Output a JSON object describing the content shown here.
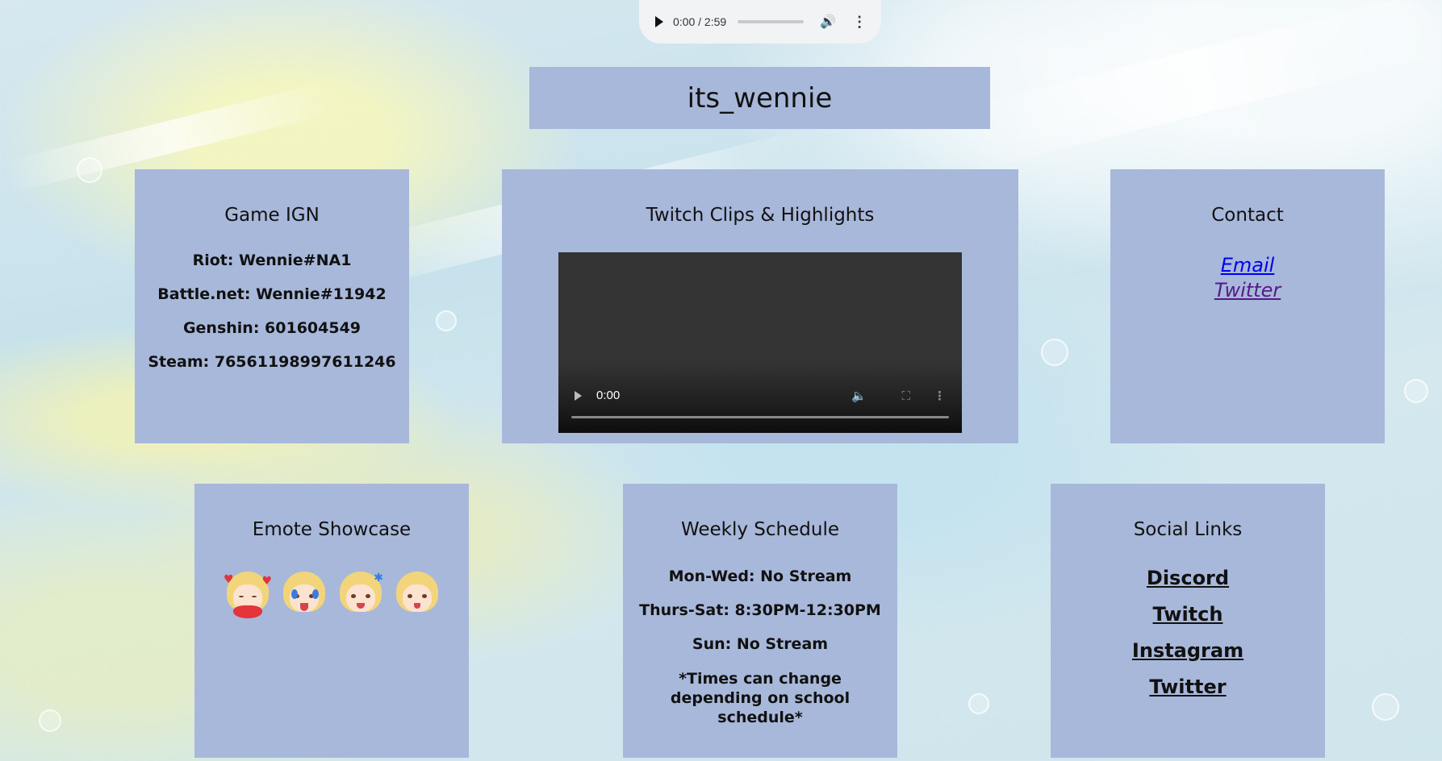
{
  "audio": {
    "time": "0:00 / 2:59",
    "progress": 0
  },
  "title": "its_wennie",
  "game_ign": {
    "heading": "Game IGN",
    "items": [
      "Riot: Wennie#NA1",
      "Battle.net: Wennie#11942",
      "Genshin: 601604549",
      "Steam: 76561198997611246"
    ]
  },
  "clips": {
    "heading": "Twitch Clips & Highlights",
    "video_time": "0:00",
    "video_progress": 0
  },
  "contact": {
    "heading": "Contact",
    "email_label": "Email",
    "twitter_label": "Twitter"
  },
  "emotes": {
    "heading": "Emote Showcase",
    "items": [
      "emote-heart",
      "emote-crying",
      "emote-angry",
      "emote-shocked"
    ]
  },
  "schedule": {
    "heading": "Weekly Schedule",
    "items": [
      "Mon-Wed: No Stream",
      "Thurs-Sat: 8:30PM-12:30PM",
      "Sun: No Stream",
      "*Times can change depending on school schedule*"
    ]
  },
  "social": {
    "heading": "Social Links",
    "links": [
      "Discord",
      "Twitch",
      "Instagram",
      "Twitter"
    ]
  },
  "colors": {
    "card_bg": "#a8b8da",
    "link_email": "#0000ee",
    "link_visited": "#551a8b"
  },
  "icons": {
    "audio": [
      "play-icon",
      "volume-icon",
      "more-options-icon"
    ],
    "video": [
      "play-icon",
      "volume-icon",
      "fullscreen-icon",
      "more-options-icon"
    ]
  }
}
